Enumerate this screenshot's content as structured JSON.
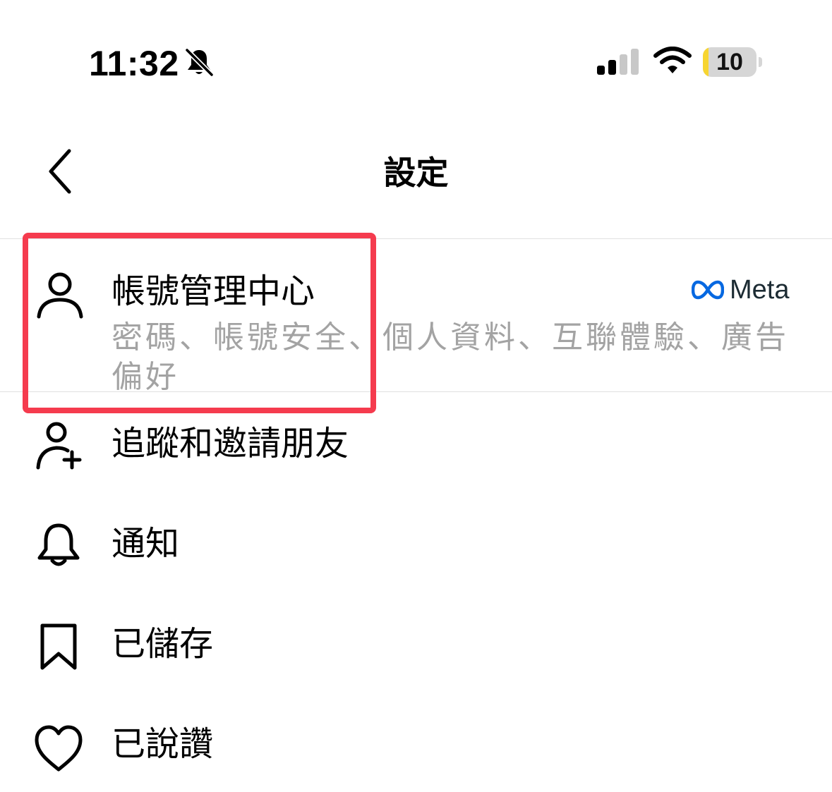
{
  "status_bar": {
    "time": "11:32",
    "battery_level": 10,
    "battery_label": "10",
    "icons": [
      "bell-slash-icon",
      "cellular-signal-icon",
      "wifi-icon",
      "battery-icon"
    ]
  },
  "header": {
    "title": "設定",
    "back_icon": "chevron-left-icon"
  },
  "account_center": {
    "title": "帳號管理中心",
    "description": "密碼、帳號安全、個人資料、互聯體驗、廣告偏好",
    "brand": "Meta",
    "icon": "person-icon"
  },
  "menu": [
    {
      "label": "追蹤和邀請朋友",
      "icon": "person-add-icon"
    },
    {
      "label": "通知",
      "icon": "bell-icon"
    },
    {
      "label": "已儲存",
      "icon": "bookmark-icon"
    },
    {
      "label": "已說讚",
      "icon": "heart-icon"
    }
  ],
  "colors": {
    "highlight": "#f53b4e",
    "secondary_text": "#a3a3a3",
    "divider": "#e0e0e0",
    "meta_blue": "#0668e1",
    "battery_fill": "#f7d531"
  }
}
